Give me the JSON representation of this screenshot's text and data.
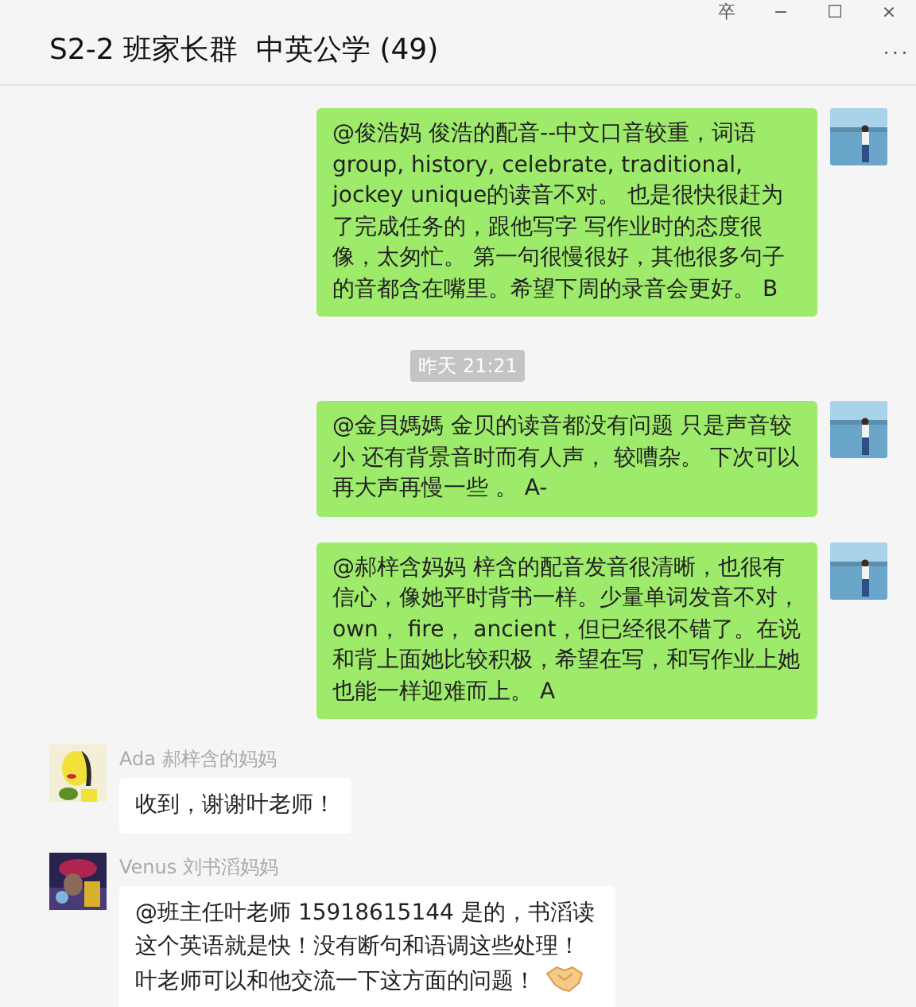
{
  "window": {
    "title": "S2-2 班家长群  中英公学 (49)",
    "controls": [
      "卒",
      "−",
      "☐",
      "×"
    ],
    "more": "···"
  },
  "messages": [
    {
      "kind": "outgoing",
      "text": "@俊浩妈 俊浩的配音--中文口音较重，词语group, history, celebrate, traditional, jockey unique的读音不对。 也是很快很赶为了完成任务的，跟他写字 写作业时的态度很像，太匆忙。 第一句很慢很好，其他很多句子的音都含在嘴里。希望下周的录音会更好。 B"
    },
    {
      "kind": "time",
      "text": "昨天 21:21"
    },
    {
      "kind": "outgoing",
      "text": "@金貝媽媽  金贝的读音都没有问题 只是声音较小 还有背景音时而有人声， 较嘈杂。 下次可以再大声再慢一些 。  A-"
    },
    {
      "kind": "outgoing",
      "text": "@郝梓含妈妈  梓含的配音发音很清晰，也很有信心，像她平时背书一样。少量单词发音不对，own， fire， ancient，但已经很不错了。在说和背上面她比较积极，希望在写，和写作业上她也能一样迎难而上。 A"
    },
    {
      "kind": "incoming",
      "sender": "Ada 郝梓含的妈妈",
      "text": "收到，谢谢叶老师！"
    },
    {
      "kind": "incoming",
      "sender": "Venus 刘书滔妈妈",
      "text": "@班主任叶老师 15918615144 是的，书滔读这个英语就是快！没有断句和语调这些处理！叶老师可以和他交流一下这方面的问题！",
      "emoji": true
    }
  ]
}
